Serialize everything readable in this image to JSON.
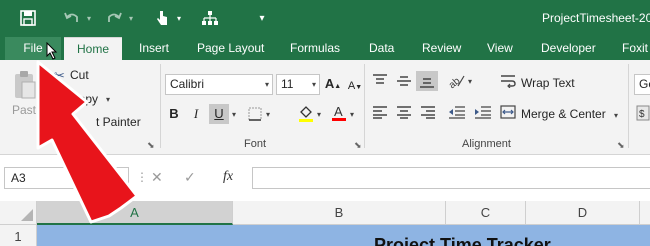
{
  "window": {
    "title": "ProjectTimesheet-20"
  },
  "tabs": [
    "File",
    "Home",
    "Insert",
    "Page Layout",
    "Formulas",
    "Data",
    "Review",
    "View",
    "Developer",
    "Foxit"
  ],
  "clipboard": {
    "paste": "Paste",
    "cut": "Cut",
    "copy": "Copy",
    "format_painter": "t Painter"
  },
  "font": {
    "name": "Calibri",
    "size": "11",
    "group_label": "Font"
  },
  "alignment": {
    "wrap_text": "Wrap Text",
    "merge_center": "Merge & Center",
    "group_label": "Alignment"
  },
  "number": {
    "format_partial": "Ge"
  },
  "formula_bar": {
    "name_box": "A3",
    "fx": "fx",
    "formula": ""
  },
  "grid": {
    "columns": [
      "A",
      "B",
      "C",
      "D"
    ],
    "rows": [
      "1"
    ],
    "cell_text": "Project Time Tracker"
  },
  "colors": {
    "brand": "#217346",
    "annotation_arrow": "#e8141b",
    "row_fill": "#8eb4e3"
  }
}
